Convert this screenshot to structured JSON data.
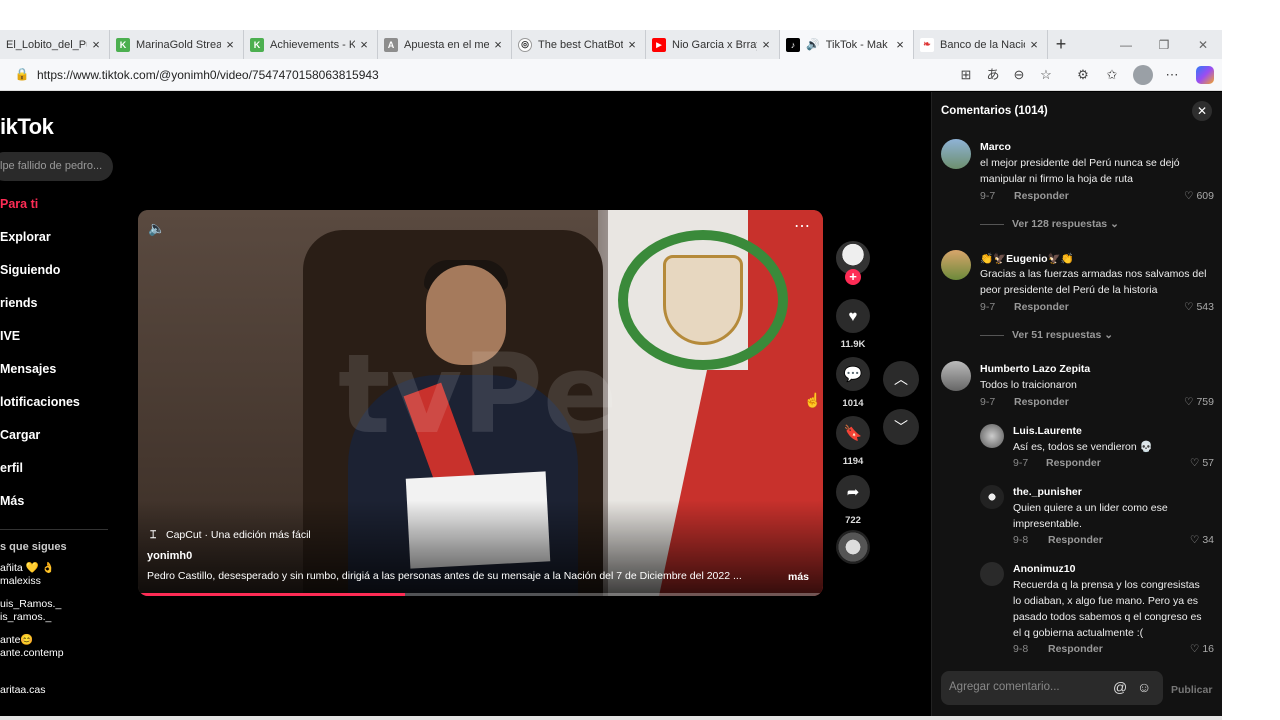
{
  "browser": {
    "tabs": [
      {
        "label": "El_Lobito_del_Pue",
        "color": "#ffffff",
        "glyph": ""
      },
      {
        "label": "MarinaGold Strea",
        "color": "#4caf50",
        "glyph": "K"
      },
      {
        "label": "Achievements - K",
        "color": "#4caf50",
        "glyph": "K"
      },
      {
        "label": "Apuesta en el mej",
        "color": "#8d8d8d",
        "glyph": "A"
      },
      {
        "label": "The best ChatBot",
        "color": "#ffffff",
        "glyph": "◎"
      },
      {
        "label": "Nio Garcia x Brray",
        "color": "#ff0000",
        "glyph": "▶"
      },
      {
        "label": "TikTok - Mak",
        "color": "#000000",
        "glyph": "♪"
      },
      {
        "label": "Banco de la Nació",
        "color": "#ffffff",
        "glyph": "❧"
      }
    ],
    "url": "https://www.tiktok.com/@yonimh0/video/7547470158063815943"
  },
  "sidebar": {
    "logo": "ikTok",
    "search_placeholder": "lpe fallido de pedro...",
    "nav": [
      "Para ti",
      "Explorar",
      "Siguiendo",
      "riends",
      "IVE",
      "Mensajes",
      "lotificaciones",
      "Cargar",
      "erfil",
      "Más"
    ],
    "following_title": "s que sigues",
    "following": [
      {
        "line1": "añita 💛 👌",
        "line2": "malexiss"
      },
      {
        "line1": "uis_Ramos._",
        "line2": "is_ramos._"
      },
      {
        "line1": "ante😊",
        "line2": "ante.contemp"
      },
      {
        "line1": "aritaa.cas",
        "line2": ""
      }
    ]
  },
  "video": {
    "watermark": "tvPe",
    "capcut": "CapCut · Una edición más fácil",
    "author": "yonimh0",
    "caption": "Pedro Castillo, desesperado y sin rumbo, dirigiá a las personas antes de su mensaje a la Nación del 7 de Diciembre del 2022 ...",
    "more": "más",
    "progress_fraction": 0.39
  },
  "actions": {
    "likes": "11.9K",
    "comments": "1014",
    "saves": "1194",
    "shares": "722"
  },
  "comments_panel": {
    "title": "Comentarios (1014)",
    "composer_placeholder": "Agregar comentario...",
    "publish": "Publicar",
    "reply_label": "Responder",
    "comments": [
      {
        "name": "Marco",
        "text": [
          "el mejor presidente del Perú nunca se dejó",
          "manipular ni firmo la hoja de ruta"
        ],
        "date": "9-7",
        "likes": "609",
        "more": "Ver 128 respuestas",
        "avatar": "#6d8f6e"
      },
      {
        "name": "👏🦅Eugenio🦅👏",
        "text": [
          "Gracias a las fuerzas armadas nos salvamos del",
          "peor presidente del Perú de la historia"
        ],
        "date": "9-7",
        "likes": "543",
        "more": "Ver 51 respuestas",
        "avatar": "#c98a3a"
      },
      {
        "name": "Humberto Lazo Zepita",
        "text": [
          "Todos lo traicionaron"
        ],
        "date": "9-7",
        "likes": "759",
        "more": "",
        "avatar": "#777777"
      }
    ],
    "replies": [
      {
        "name": "Luis.Laurente",
        "text": [
          "Así es, todos se vendieron 💀"
        ],
        "date": "9-7",
        "likes": "57",
        "avatar": "#888888"
      },
      {
        "name": "the._punisher",
        "text": [
          "Quien quiere a un lider como ese",
          "impresentable."
        ],
        "date": "9-8",
        "likes": "34",
        "avatar": "#444444"
      },
      {
        "name": "Anonimuz10",
        "text": [
          "Recuerda q la prensa y los congresistas",
          "lo odiaban, x algo fue mano. Pero ya es",
          "pasado todos sabemos q el congreso es",
          "el q gobierna actualmente :("
        ],
        "date": "9-8",
        "likes": "16",
        "avatar": "#2f2f2f"
      }
    ]
  },
  "colors": {
    "accent": "#fe2c55",
    "panel": "#121212"
  }
}
